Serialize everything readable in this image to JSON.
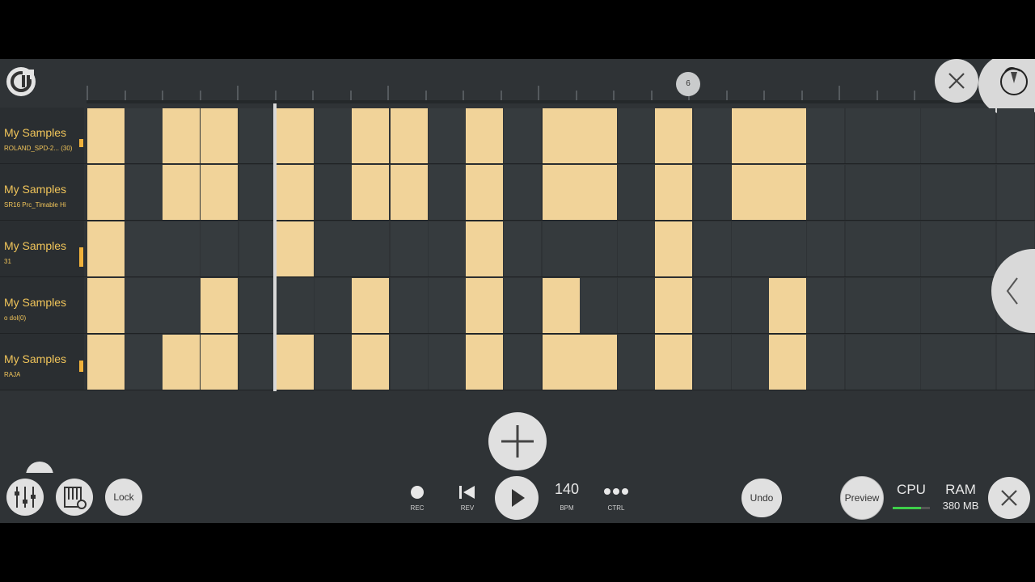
{
  "timeline": {
    "bar_marker": "6"
  },
  "rows": [
    {
      "title": "My Samples",
      "sub": "ROLAND_SPD-2... (30)",
      "steps": [
        1,
        0,
        1,
        1,
        0,
        1,
        0,
        1,
        1,
        0,
        1,
        0,
        1,
        1,
        0,
        1,
        0,
        1,
        1,
        0,
        0,
        0,
        0,
        0,
        0,
        0,
        0,
        0,
        0,
        0,
        0,
        0
      ]
    },
    {
      "title": "My Samples",
      "sub": "SR16 Prc_Timable Hi",
      "steps": [
        1,
        0,
        1,
        1,
        0,
        1,
        0,
        1,
        1,
        0,
        1,
        0,
        1,
        1,
        0,
        1,
        0,
        1,
        1,
        0,
        0,
        0,
        0,
        0,
        0,
        0,
        0,
        0,
        0,
        0,
        0,
        0
      ]
    },
    {
      "title": "My Samples",
      "sub": "31",
      "steps": [
        1,
        0,
        0,
        0,
        0,
        1,
        0,
        0,
        0,
        0,
        1,
        0,
        0,
        0,
        0,
        1,
        0,
        0,
        0,
        0,
        0,
        0,
        0,
        0,
        0,
        0,
        0,
        0,
        0,
        0,
        0,
        0
      ]
    },
    {
      "title": "My Samples",
      "sub": "o dol(0)",
      "steps": [
        1,
        0,
        0,
        1,
        0,
        0,
        0,
        1,
        0,
        0,
        1,
        0,
        1,
        0,
        0,
        1,
        0,
        0,
        1,
        0,
        0,
        0,
        0,
        0,
        0,
        0,
        0,
        0,
        0,
        0,
        0,
        0
      ]
    },
    {
      "title": "My Samples",
      "sub": "RAJA",
      "steps": [
        1,
        0,
        1,
        1,
        0,
        1,
        0,
        1,
        0,
        0,
        1,
        0,
        1,
        1,
        0,
        1,
        0,
        0,
        1,
        0,
        0,
        0,
        0,
        0,
        0,
        0,
        0,
        0,
        0,
        0,
        0,
        0
      ]
    }
  ],
  "toolbar": {
    "lock_label": "Lock",
    "rec_label": "REC",
    "rev_label": "REV",
    "tempo_value": "140",
    "tempo_label": "BPM",
    "ctrl_label": "CTRL",
    "undo_label": "Undo",
    "preview_label": "Preview",
    "cpu_label": "CPU",
    "ram_label": "RAM",
    "ram_value": "380 MB"
  },
  "colors": {
    "accent": "#f1c55a",
    "step_on": "#f1d399",
    "background": "#2f3336"
  },
  "icons": [
    "logo-icon",
    "close-icon",
    "fl-fruit-icon",
    "chevron-left-icon",
    "plus-icon",
    "mixer-icon",
    "piano-settings-icon",
    "record-icon",
    "rewind-icon",
    "play-icon",
    "more-icon",
    "close-icon"
  ]
}
